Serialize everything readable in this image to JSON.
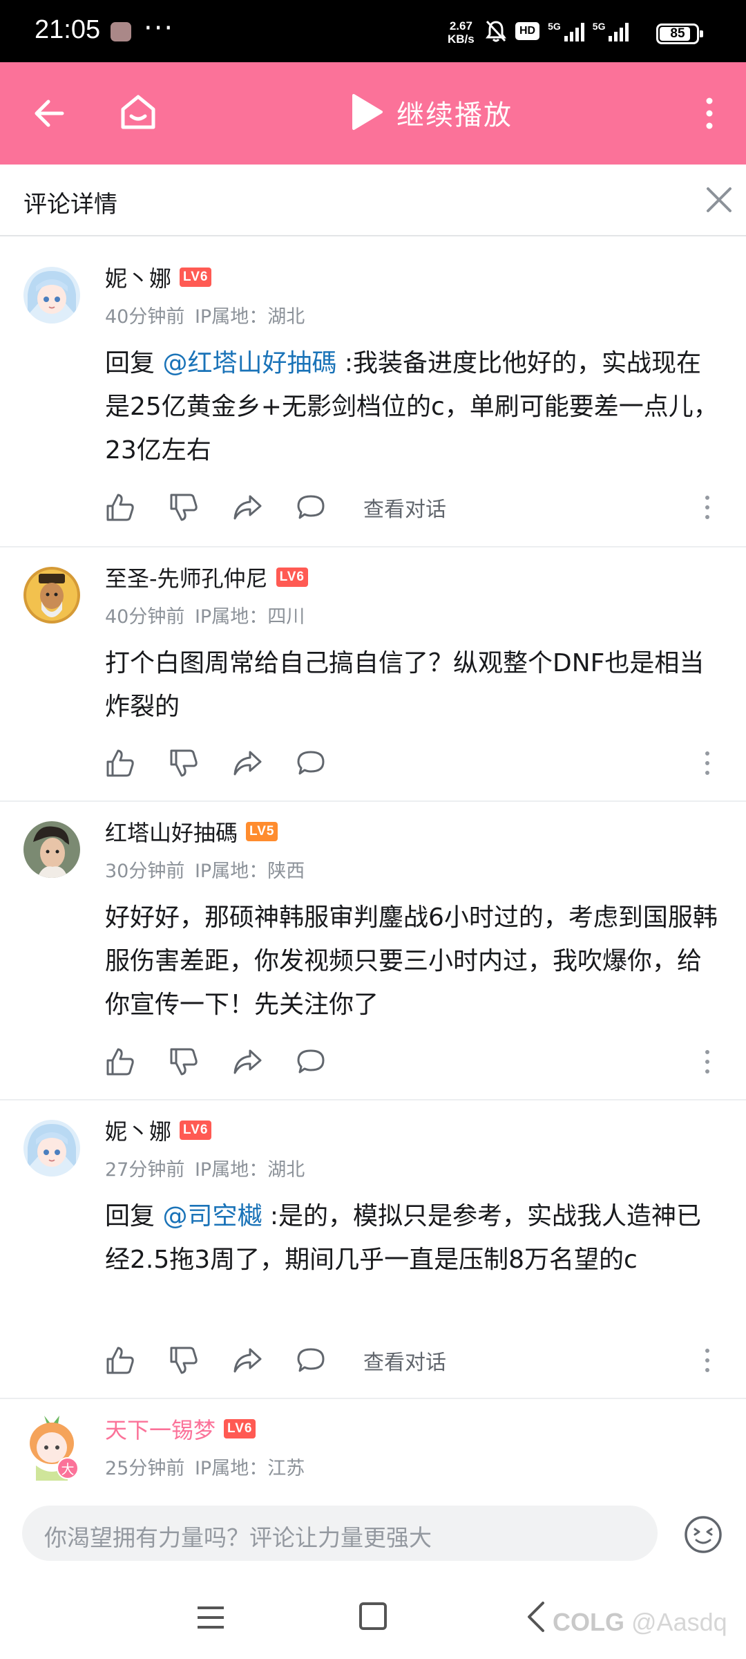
{
  "status_bar": {
    "time": "21:05",
    "more": "···",
    "net_speed_value": "2.67",
    "net_speed_unit": "KB/s",
    "hd": "HD",
    "signal_1": "5G",
    "signal_2": "5G",
    "battery": "85",
    "battery_level_percent": 85
  },
  "toolbar": {
    "resume_label": "继续播放",
    "accent_color": "#fb7299"
  },
  "panel": {
    "title": "评论详情"
  },
  "comments": [
    {
      "username": "妮丶娜",
      "level": "LV6",
      "time": "40分钟前",
      "ip": "IP属地：湖北",
      "reply_prefix": "回复 ",
      "mention": "@红塔山好抽碼",
      "text": " :我装备进度比他好的，实战现在是25亿黄金乡+无影剑档位的c，单刷可能要差一点儿，23亿左右",
      "view_conversation": "查看对话"
    },
    {
      "username": "至圣-先师孔仲尼",
      "level": "LV6",
      "time": "40分钟前",
      "ip": "IP属地：四川",
      "text": "打个白图周常给自己搞自信了？纵观整个DNF也是相当炸裂的"
    },
    {
      "username": "红塔山好抽碼",
      "level": "LV5",
      "time": "30分钟前",
      "ip": "IP属地：陕西",
      "text": "好好好，那硕神韩服审判鏖战6小时过的，考虑到国服韩服伤害差距，你发视频只要三小时内过，我吹爆你，给你宣传一下！先关注你了"
    },
    {
      "username": "妮丶娜",
      "level": "LV6",
      "time": "27分钟前",
      "ip": "IP属地：湖北",
      "reply_prefix": "回复 ",
      "mention": "@司空樾",
      "text": " :是的，模拟只是参考，实战我人造神已经2.5拖3周了，期间几乎一直是压制8万名望的c",
      "view_conversation": "查看对话"
    },
    {
      "username": "天下一锡梦",
      "level": "LV6",
      "time": "25分钟前",
      "ip": "IP属地：江苏",
      "avatar_badge": "大"
    }
  ],
  "input": {
    "placeholder": "你渴望拥有力量吗？评论让力量更强大"
  },
  "watermark": {
    "brand": "COLG",
    "handle": "@Aasdq"
  }
}
